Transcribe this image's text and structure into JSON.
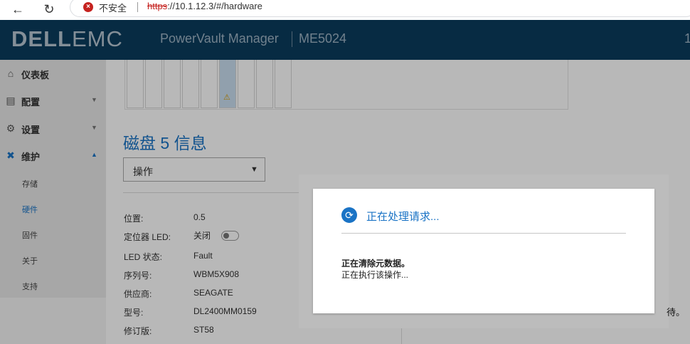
{
  "browser": {
    "back_icon": "arrow-left-icon",
    "reload_icon": "reload-icon",
    "security_label": "不安全",
    "url_scheme": "https",
    "url_rest": "://10.1.12.3/#/hardware"
  },
  "header": {
    "logo_dell": "DΕLL",
    "logo_emc": "EMC",
    "product": "PowerVault Manager",
    "model": "ME5024",
    "right_text": "1",
    "colors": {
      "header_bg": "#0b3c5d",
      "accent": "#1a73c5"
    }
  },
  "sidebar": {
    "items": [
      {
        "label": "仪表板",
        "icon": "home-icon"
      },
      {
        "label": "配置",
        "icon": "database-icon"
      },
      {
        "label": "设置",
        "icon": "gear-icon"
      },
      {
        "label": "维护",
        "icon": "tools-icon"
      }
    ],
    "sub_items": [
      {
        "label": "存储"
      },
      {
        "label": "硬件"
      },
      {
        "label": "固件"
      },
      {
        "label": "关于"
      },
      {
        "label": "支持"
      }
    ]
  },
  "main": {
    "warning_icon": "warning-triangle-icon",
    "disk_title": "磁盘 5 信息",
    "actions_label": "操作",
    "properties": [
      {
        "label": "位置:",
        "value": "0.5"
      },
      {
        "label": "定位器 LED:",
        "value": "关闭"
      },
      {
        "label": "LED 状态:",
        "value": "Fault"
      },
      {
        "label": "序列号:",
        "value": "WBM5X908"
      },
      {
        "label": "供应商:",
        "value": "SEAGATE"
      },
      {
        "label": "型号:",
        "value": "DL2400MM0159"
      },
      {
        "label": "修订版:",
        "value": "ST58"
      }
    ],
    "partial_right_text": "待。"
  },
  "modal": {
    "title": "正在处理请求...",
    "message_bold": "正在清除元数据。",
    "message": "正在执行该操作..."
  }
}
